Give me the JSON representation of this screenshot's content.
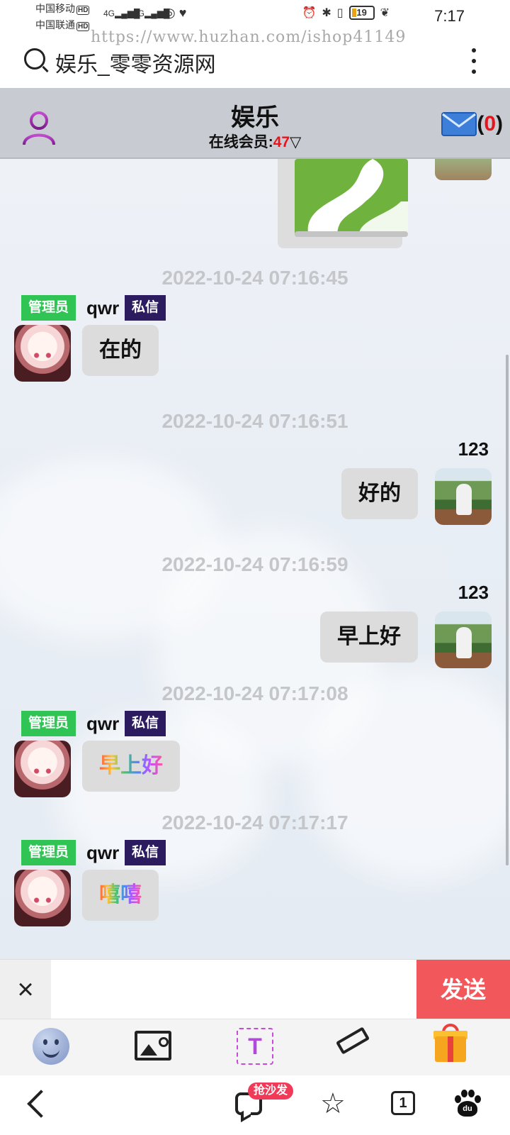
{
  "status_bar": {
    "carrier_1": "中国移动",
    "carrier_2": "中国联通",
    "hd_label": "HD",
    "signal_1": "4G",
    "signal_2": "4G",
    "battery": "19",
    "time": "7:17"
  },
  "watermark": "https://www.huzhan.com/ishop41149",
  "browser": {
    "title": "娱乐_零零资源网"
  },
  "header": {
    "room_title": "娱乐",
    "online_label": "在线会员:",
    "online_count": "47",
    "online_arrow": "▽",
    "mail_open": "(",
    "mail_count": "0",
    "mail_close": ")"
  },
  "messages": [
    {
      "time": "2022-10-24 07:16:45",
      "side": "left",
      "role": "管理员",
      "user": "qwr",
      "pm": "私信",
      "text": "在的"
    },
    {
      "time": "2022-10-24 07:16:51",
      "side": "right",
      "user": "123",
      "text": "好的"
    },
    {
      "time": "2022-10-24 07:16:59",
      "side": "right",
      "user": "123",
      "text": "早上好"
    },
    {
      "time": "2022-10-24 07:17:08",
      "side": "left",
      "role": "管理员",
      "user": "qwr",
      "pm": "私信",
      "text": "早上好",
      "style": "rainbow"
    },
    {
      "time": "2022-10-24 07:17:17",
      "side": "left",
      "role": "管理员",
      "user": "qwr",
      "pm": "私信",
      "text": "嘻嘻",
      "style": "rainbow"
    }
  ],
  "input": {
    "close_label": "×",
    "placeholder": "",
    "send_label": "发送"
  },
  "toolbar": {
    "text_label": "T"
  },
  "bottom_nav": {
    "badge": "抢沙发",
    "star": "☆",
    "tab_count": "1",
    "baidu_label": "du"
  },
  "colors": {
    "admin_badge": "#2fc454",
    "pm_badge": "#2c1c5f",
    "send_button": "#f2585b",
    "header_bg": "#c8cbd1",
    "online_count": "#e8141c"
  }
}
